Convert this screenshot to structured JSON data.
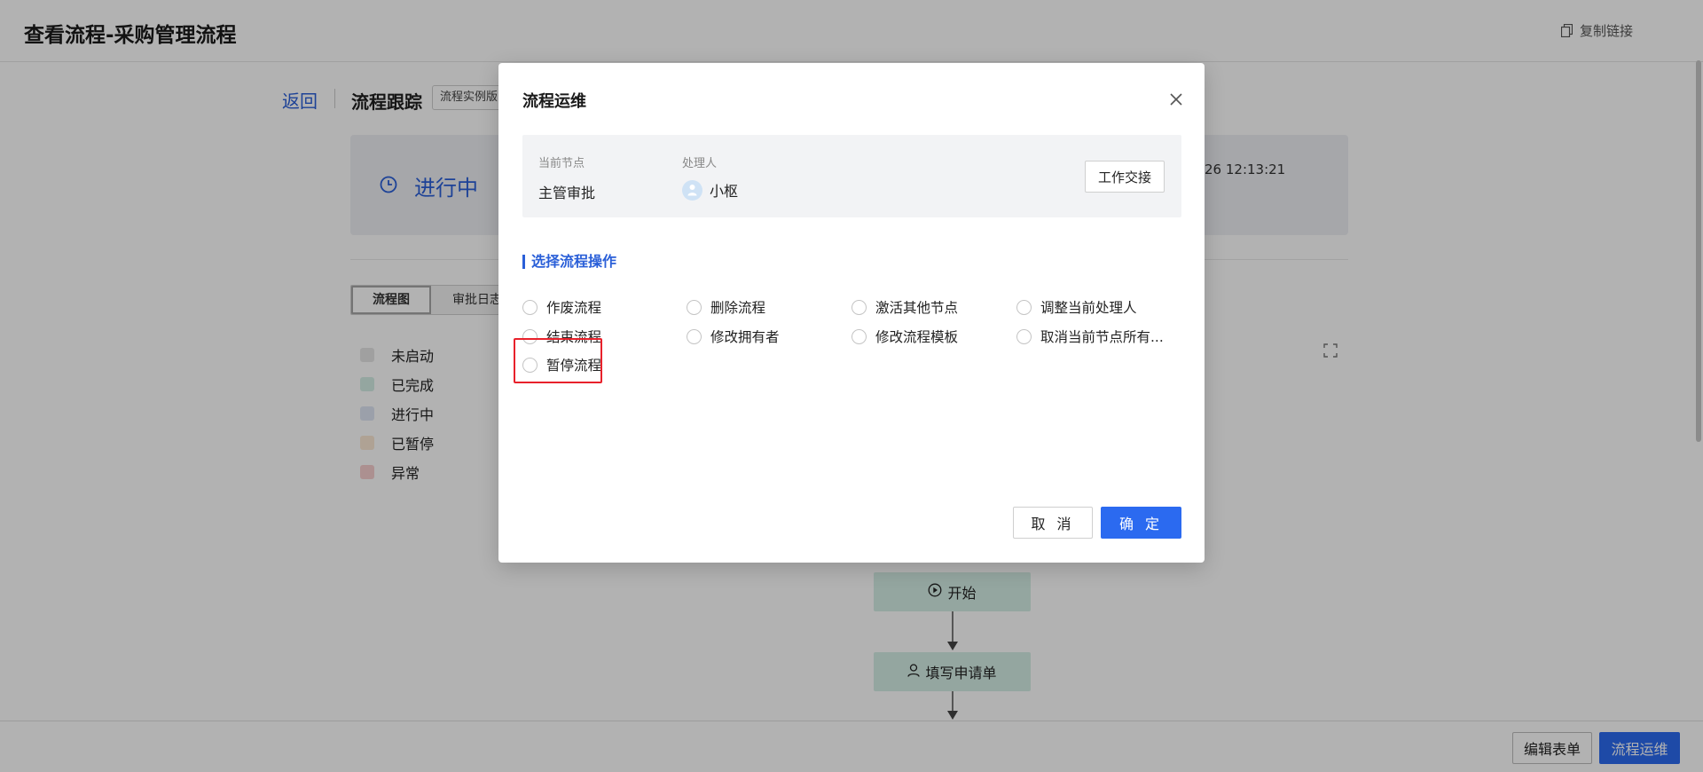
{
  "page": {
    "title": "查看流程-采购管理流程",
    "copy_link_label": "复制链接"
  },
  "tracking": {
    "back_label": "返回",
    "section_title": "流程跟踪",
    "version_tag": "流程实例版",
    "status_text": "进行中",
    "status_time_partial": "26 12:13:21",
    "tabs": [
      {
        "label": "流程图",
        "active": true
      },
      {
        "label": "审批日志",
        "active": false
      }
    ],
    "legend": [
      {
        "label": "未启动",
        "color": "#e6e6e6"
      },
      {
        "label": "已完成",
        "color": "#d5eee6"
      },
      {
        "label": "进行中",
        "color": "#dfe6f4"
      },
      {
        "label": "已暂停",
        "color": "#fbe8d5"
      },
      {
        "label": "异常",
        "color": "#f7cfcf"
      }
    ],
    "nodes": [
      {
        "label": "开始",
        "icon": "play-circle-icon"
      },
      {
        "label": "填写申请单",
        "icon": "user-icon"
      }
    ]
  },
  "bottom_bar": {
    "edit_form_label": "编辑表单",
    "flow_ops_label": "流程运维"
  },
  "modal": {
    "title": "流程运维",
    "current_node_label": "当前节点",
    "current_node_value": "主管审批",
    "handler_label": "处理人",
    "handler_name": "小枢",
    "handover_label": "工作交接",
    "operations_heading": "选择流程操作",
    "operations": [
      [
        "作废流程",
        "删除流程",
        "激活其他节点",
        "调整当前处理人"
      ],
      [
        "结束流程",
        "修改拥有者",
        "修改流程模板",
        "取消当前节点所有..."
      ],
      [
        "暂停流程"
      ]
    ],
    "cancel_label": "取 消",
    "ok_label": "确 定"
  },
  "colors": {
    "accent": "#2b6af0",
    "link": "#2a5fd8",
    "highlight": "#e8212b",
    "node_done": "#d5eee6"
  }
}
